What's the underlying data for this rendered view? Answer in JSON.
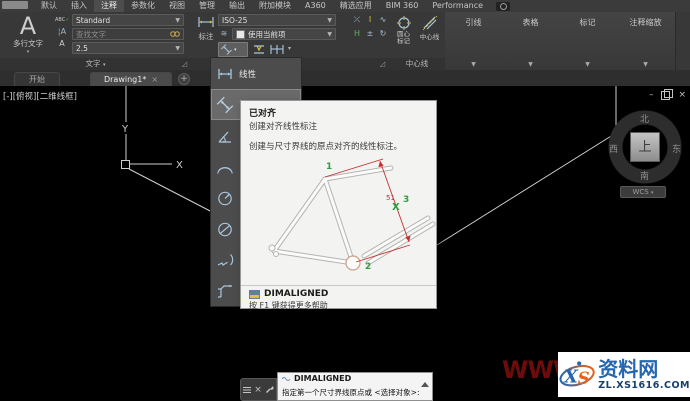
{
  "tab_bar": {
    "tabs": [
      "默认",
      "插入",
      "注释",
      "参数化",
      "视图",
      "管理",
      "输出",
      "附加模块",
      "A360",
      "精选应用",
      "BIM 360",
      "Performance"
    ],
    "active_tab": "注释"
  },
  "ribbon": {
    "text_panel": {
      "label": "文字",
      "mtext_label": "多行文字",
      "mtext_glyph": "A",
      "style_value": "Standard",
      "find_placeholder": "查找文字",
      "height_value": "2.5"
    },
    "dim_panel": {
      "label": "标注",
      "dim_button_label": "标注",
      "style_value": "ISO-25",
      "layer_value": "使用当前项"
    },
    "centerline_panel": {
      "label": "中心线",
      "center_mark_line1": "圆心",
      "center_mark_line2": "标记",
      "centerline_label": "中心线"
    },
    "collapsed_panels": [
      "引线",
      "表格",
      "标记",
      "注释缩放"
    ]
  },
  "file_tabs": {
    "start_tab": "开始",
    "drawing_tab": "Drawing1*",
    "close_glyph": "×",
    "new_glyph": "+"
  },
  "canvas": {
    "viewport_label": "[-][俯视][二维线框]",
    "ucs_x": "X",
    "ucs_y": "Y"
  },
  "dim_menu": {
    "visible_labels": [
      "线性",
      "已对齐"
    ],
    "icon_items": [
      "linear-dimension",
      "aligned-dimension",
      "angular-dimension",
      "arc-length-dimension",
      "radius-dimension",
      "diameter-dimension",
      "jogged-dimension",
      "ordinate-dimension"
    ],
    "hovered_item": "已对齐"
  },
  "tooltip": {
    "title": "已对齐",
    "subtitle": "创建对齐线性标注",
    "description": "创建与尺寸界线的原点对齐的线性标注。",
    "command": "DIMALIGNED",
    "help_text": "按 F1 键获得更多帮助",
    "figure": {
      "label_1": "1",
      "label_2": "2",
      "label_3": "3",
      "dim_value": "51",
      "marker": "X"
    }
  },
  "viewcube": {
    "north": "北",
    "south": "南",
    "west": "西",
    "east": "东",
    "top": "上",
    "wcs_label": "WCS"
  },
  "window_controls": {
    "minimize": "–",
    "close": "×"
  },
  "command_dock": {
    "command_name": "DIMALIGNED",
    "prompt": "指定第一个尺寸界线原点或 <选择对象>:",
    "close_glyph": "×"
  },
  "watermark": {
    "red_text": "WWW",
    "logo_x": "X",
    "logo_s": "S",
    "site_name": "资料网",
    "site_url": "ZL.XS1616.COM"
  },
  "colors": {
    "icon_blue": "#a9c6dd",
    "dim_red": "#c53030",
    "label_green": "#2f9e3d",
    "watermark_blue": "#2566ae",
    "watermark_orange": "#e8641b"
  }
}
